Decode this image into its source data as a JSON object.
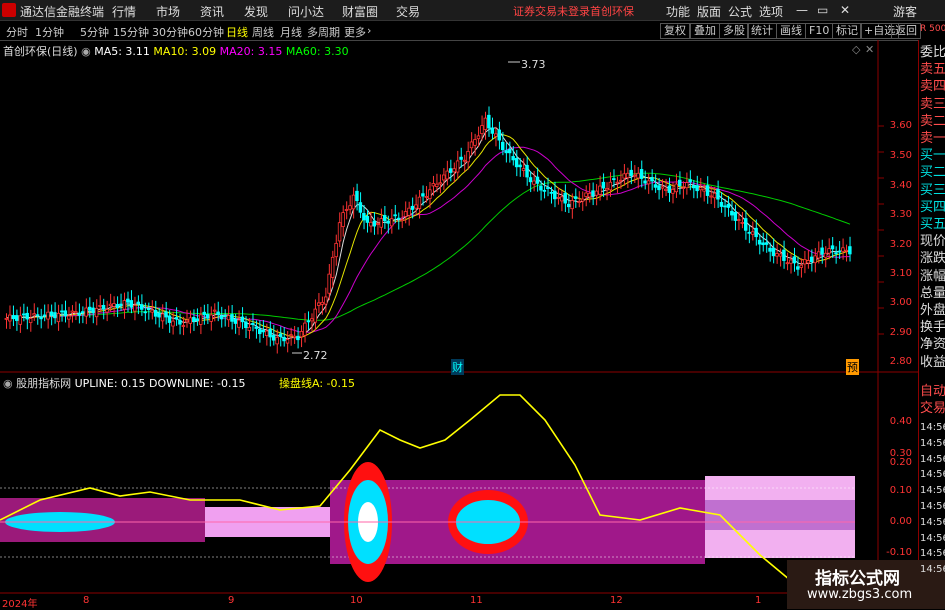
{
  "app": {
    "title": "通达信金融终端"
  },
  "menu": [
    "行情",
    "市场",
    "资讯",
    "发现",
    "问小达",
    "财富圈",
    "交易"
  ],
  "menu_right": {
    "notice": "证券交易未登录",
    "stock": "首创环保",
    "items": [
      "功能",
      "版面",
      "公式",
      "选项"
    ],
    "guest": "游客"
  },
  "periods": [
    "分时",
    "1分钟",
    "5分钟",
    "15分钟",
    "30分钟",
    "60分钟",
    "日线",
    "周线",
    "月线",
    "多周期",
    "更多"
  ],
  "active_period": "日线",
  "toolbar": [
    "复权",
    "叠加",
    "多股",
    "统计",
    "画线",
    "F10",
    "标记",
    "+自选",
    "返回"
  ],
  "main_legend": {
    "name": "首创环保(日线)",
    "ma5": "MA5: 3.11",
    "ma10": "MA10: 3.09",
    "ma20": "MA20: 3.15",
    "ma60": "MA60: 3.30"
  },
  "price_axis": [
    "3.60",
    "3.50",
    "3.40",
    "3.30",
    "3.20",
    "3.10",
    "3.00",
    "2.90",
    "2.80"
  ],
  "annotations": {
    "high": "3.73",
    "low": "2.72",
    "cai": "财",
    "yu": "预"
  },
  "sub_legend": {
    "name": "股朋指标网",
    "upline": "UPLINE: 0.15",
    "downline": "DOWNLINE: -0.15",
    "cao": "操盘线A: -0.15"
  },
  "sub_axis": [
    "0.40",
    "0.30",
    "0.20",
    "0.10",
    "0.00",
    "-0.10"
  ],
  "right_panel": {
    "rp": "R 500",
    "labels": [
      "委比",
      "卖五",
      "卖四",
      "卖三",
      "卖二",
      "卖一",
      "买一",
      "买二",
      "买三",
      "买四",
      "买五",
      "现价",
      "涨跌",
      "涨幅",
      "总量",
      "外盘",
      "换手",
      "净资",
      "收益"
    ],
    "bottom": [
      "自动",
      "交易"
    ],
    "times": [
      "14:56",
      "14:56",
      "14:56",
      "14:56",
      "14:56",
      "14:56",
      "14:56",
      "14:56",
      "14:56",
      "14:56"
    ]
  },
  "date_axis": [
    "2024年",
    "8",
    "9",
    "10",
    "11",
    "12",
    "1"
  ],
  "watermark": {
    "title": "指标公式网",
    "url": "www.zbgs3.com"
  },
  "colors": {
    "up": "#ff3333",
    "down": "#00ffff",
    "ma5": "#ffffff",
    "ma10": "#ffff00",
    "ma20": "#ff00ff",
    "ma60": "#00ff00"
  }
}
